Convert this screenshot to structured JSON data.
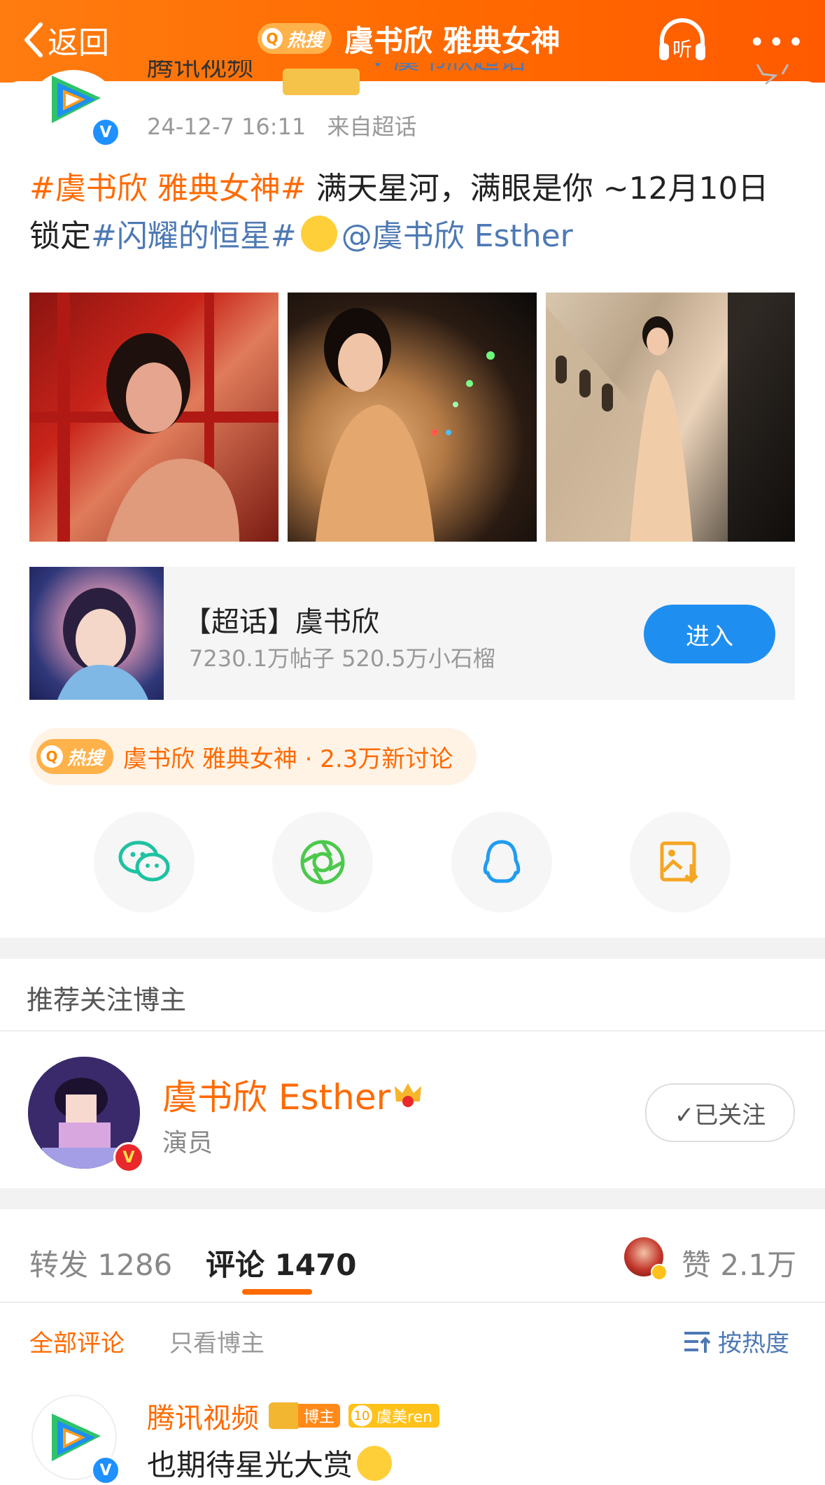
{
  "nav": {
    "back_label": "返回",
    "hot_badge": "热搜",
    "title": "虞书欣 雅典女神",
    "listen_label": "听"
  },
  "post": {
    "author": "腾讯视频",
    "topic": "虞书欣超话",
    "time": "24-12-7 16:11",
    "source": "来自超话",
    "text_tag": "#虞书欣 雅典女神#",
    "text_body": " 满天星河，满眼是你 ~12月10日锁定",
    "text_tag2": "#闪耀的恒星#",
    "text_mention": "@虞书欣 Esther"
  },
  "supertopic": {
    "title": "【超话】虞书欣",
    "stats": "7230.1万帖子 520.5万小石榴",
    "button": "进入"
  },
  "hot_search": {
    "badge": "热搜",
    "text": "虞书欣 雅典女神 · 2.3万新讨论"
  },
  "share_icons": [
    "wechat-icon",
    "moments-icon",
    "qq-icon",
    "save-image-icon"
  ],
  "recommend": {
    "title": "推荐关注博主",
    "name": "虞书欣 Esther",
    "role": "演员",
    "follow_label": "✓已关注"
  },
  "stats": {
    "repost_label": "转发",
    "repost_count": "1286",
    "comment_label": "评论",
    "comment_count": "1470",
    "like_label": "赞",
    "like_count": "2.1万"
  },
  "filters": {
    "all": "全部评论",
    "blogger_only": "只看博主",
    "sort": "按热度"
  },
  "comment": {
    "author": "腾讯视频",
    "host_badge": "博主",
    "fan_level": "10",
    "fan_label": "虞美ren",
    "text": "也期待星光大赏"
  },
  "colors": {
    "accent": "#ff6a00",
    "link": "#4d79b4",
    "button": "#1e8ff0"
  }
}
